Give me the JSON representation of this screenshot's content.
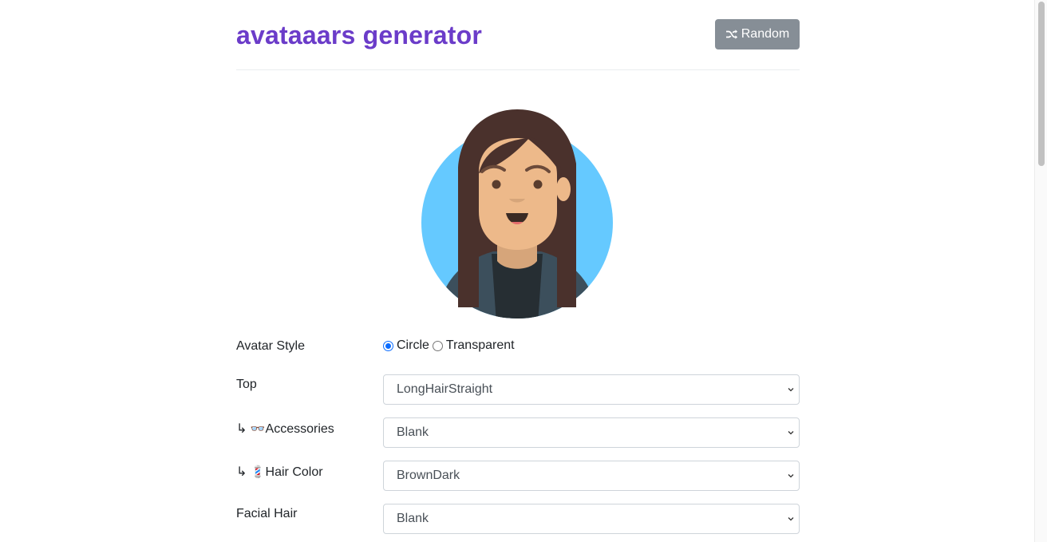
{
  "header": {
    "title": "avataaars generator",
    "random_label": "Random"
  },
  "avatar": {
    "background_color": "#65c9ff",
    "hair_color": "#4a312c",
    "skin_color": "#edb98a",
    "clothes_color": "#3c4f5c"
  },
  "form": {
    "avatar_style": {
      "label": "Avatar Style",
      "options": [
        "Circle",
        "Transparent"
      ],
      "selected": "Circle"
    },
    "top": {
      "label": "Top",
      "value": "LongHairStraight"
    },
    "accessories": {
      "prefix": "↳",
      "emoji": "👓",
      "label": "Accessories",
      "value": "Blank"
    },
    "hair_color": {
      "prefix": "↳",
      "emoji": "💈",
      "label": "Hair Color",
      "value": "BrownDark"
    },
    "facial_hair": {
      "label": "Facial Hair",
      "value": "Blank"
    }
  }
}
